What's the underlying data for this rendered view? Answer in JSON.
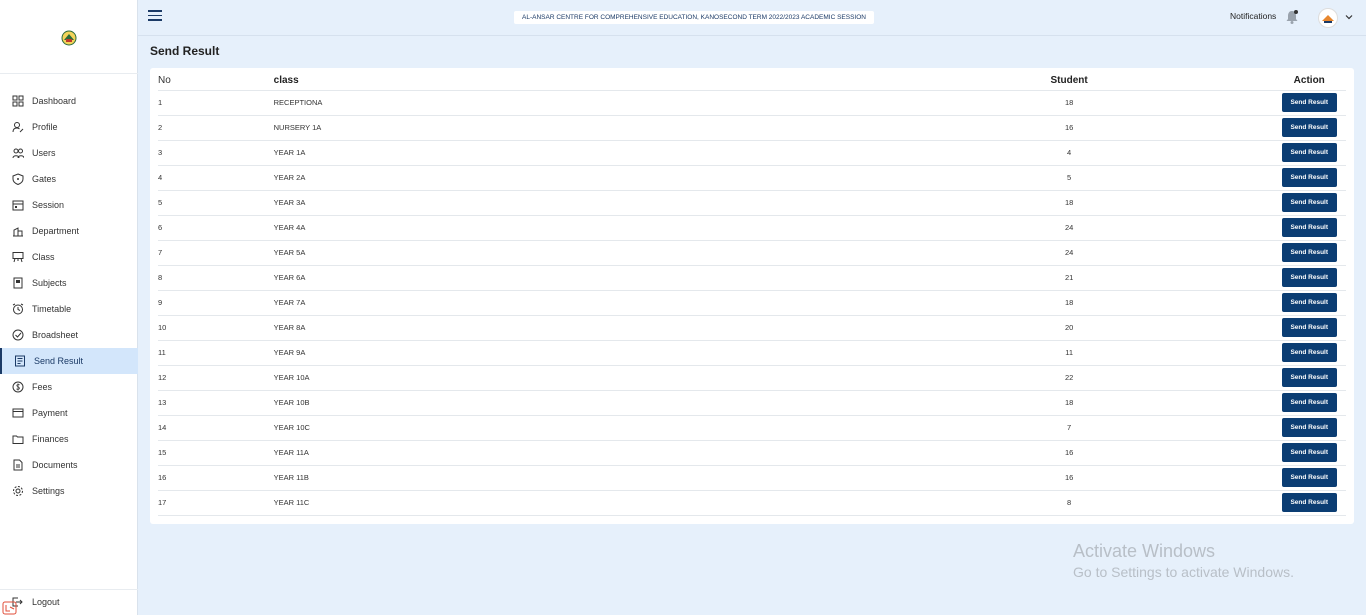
{
  "sidebar": {
    "logo_icon": "school-logo-icon",
    "items": [
      {
        "label": "Dashboard",
        "icon": "dashboard-icon",
        "active": false
      },
      {
        "label": "Profile",
        "icon": "user-edit-icon",
        "active": false
      },
      {
        "label": "Users",
        "icon": "users-icon",
        "active": false
      },
      {
        "label": "Gates",
        "icon": "shield-icon",
        "active": false
      },
      {
        "label": "Session",
        "icon": "calendar-icon",
        "active": false
      },
      {
        "label": "Department",
        "icon": "building-icon",
        "active": false
      },
      {
        "label": "Class",
        "icon": "easel-icon",
        "active": false
      },
      {
        "label": "Subjects",
        "icon": "book-icon",
        "active": false
      },
      {
        "label": "Timetable",
        "icon": "alarm-clock-icon",
        "active": false
      },
      {
        "label": "Broadsheet",
        "icon": "check-circle-icon",
        "active": false
      },
      {
        "label": "Send Result",
        "icon": "list-document-icon",
        "active": true
      },
      {
        "label": "Fees",
        "icon": "dollar-coin-icon",
        "active": false
      },
      {
        "label": "Payment",
        "icon": "card-icon",
        "active": false
      },
      {
        "label": "Finances",
        "icon": "folder-icon",
        "active": false
      },
      {
        "label": "Documents",
        "icon": "document-icon",
        "active": false
      },
      {
        "label": "Settings",
        "icon": "gear-icon",
        "active": false
      }
    ],
    "logout_label": "Logout"
  },
  "header": {
    "school_name": "AL-ANSAR CENTRE FOR COMPREHENSIVE EDUCATION, KANO",
    "session": "SECOND TERM 2022/2023 ACADEMIC SESSION",
    "notifications_label": "Notifications"
  },
  "page": {
    "title": "Send Result"
  },
  "table": {
    "columns": [
      "No",
      "class",
      "Student",
      "Action"
    ],
    "button_label": "Send Result",
    "rows": [
      {
        "no": "1",
        "class": "RECEPTIONA",
        "student": "18"
      },
      {
        "no": "2",
        "class": "NURSERY 1A",
        "student": "16"
      },
      {
        "no": "3",
        "class": "YEAR 1A",
        "student": "4"
      },
      {
        "no": "4",
        "class": "YEAR 2A",
        "student": "5"
      },
      {
        "no": "5",
        "class": "YEAR 3A",
        "student": "18"
      },
      {
        "no": "6",
        "class": "YEAR 4A",
        "student": "24"
      },
      {
        "no": "7",
        "class": "YEAR 5A",
        "student": "24"
      },
      {
        "no": "8",
        "class": "YEAR 6A",
        "student": "21"
      },
      {
        "no": "9",
        "class": "YEAR 7A",
        "student": "18"
      },
      {
        "no": "10",
        "class": "YEAR 8A",
        "student": "20"
      },
      {
        "no": "11",
        "class": "YEAR 9A",
        "student": "11"
      },
      {
        "no": "12",
        "class": "YEAR 10A",
        "student": "22"
      },
      {
        "no": "13",
        "class": "YEAR 10B",
        "student": "18"
      },
      {
        "no": "14",
        "class": "YEAR 10C",
        "student": "7"
      },
      {
        "no": "15",
        "class": "YEAR 11A",
        "student": "16"
      },
      {
        "no": "16",
        "class": "YEAR 11B",
        "student": "16"
      },
      {
        "no": "17",
        "class": "YEAR 11C",
        "student": "8"
      }
    ]
  },
  "watermark": {
    "line1": "Activate Windows",
    "line2": "Go to Settings to activate Windows."
  },
  "colors": {
    "accent": "#0b3d73",
    "page_bg": "#e6f0fb",
    "active_nav_bg": "#d3e6fb"
  }
}
